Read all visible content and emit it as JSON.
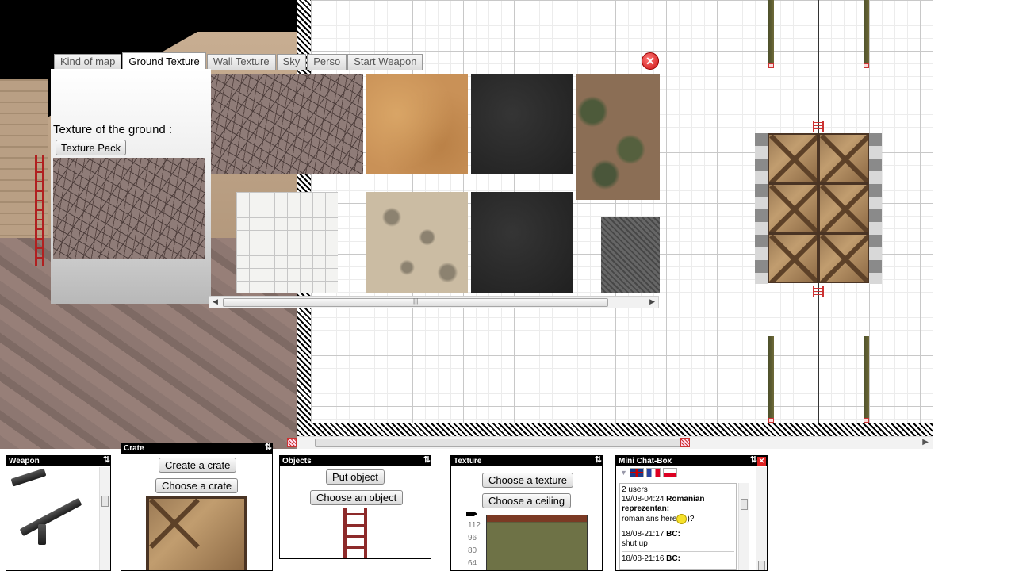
{
  "dialog": {
    "tabs": [
      "Kind of map",
      "Ground Texture",
      "Wall Texture",
      "Sky",
      "Perso",
      "Start Weapon"
    ],
    "active_tab": "Ground Texture",
    "ground_label": "Texture of the ground :",
    "texture_pack_label": "Texture Pack",
    "close_icon": "close-icon"
  },
  "crate_panel": {
    "title": "Crate",
    "create_label": "Create a crate",
    "choose_label": "Choose a crate"
  },
  "weapon_panel": {
    "title": "Weapon"
  },
  "objects_panel": {
    "title": "Objects",
    "put_label": "Put object",
    "choose_label": "Choose an object"
  },
  "texture_panel": {
    "title": "Texture",
    "choose_texture_label": "Choose a texture",
    "choose_ceiling_label": "Choose a ceiling",
    "heights": [
      "112",
      "96",
      "80",
      "64"
    ]
  },
  "chat": {
    "title": "Mini Chat-Box",
    "users": "2 users",
    "messages": [
      {
        "meta": "19/08-04:24",
        "author": "Romanian reprezentan",
        "text": "romanians here",
        "suffix": ")?"
      },
      {
        "meta": "18/08-21:17",
        "author": "BC",
        "text": "shut up"
      },
      {
        "meta": "18/08-21:16",
        "author": "BC",
        "text": ""
      }
    ]
  },
  "colors": {
    "titlebar": "#000000",
    "close_red": "#cc1111",
    "ladder_red": "#b02020"
  }
}
